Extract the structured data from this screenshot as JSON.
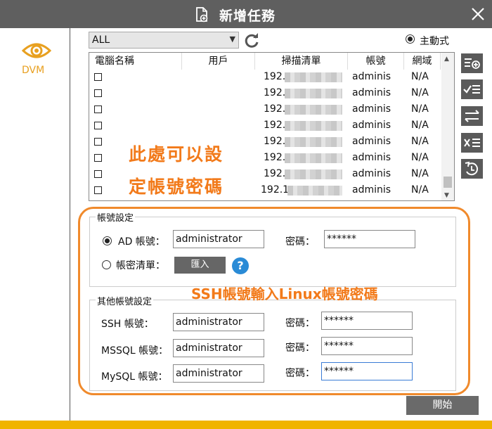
{
  "window": {
    "title": "新增任務",
    "close_icon": "close-icon"
  },
  "sidebar": {
    "label": "DVM",
    "icon": "eye-icon"
  },
  "toolbar": {
    "filter_value": "ALL",
    "active_mode_label": "主動式"
  },
  "table": {
    "headers": [
      "電腦名稱",
      "用戶",
      "掃描清單",
      "帳號",
      "網域"
    ],
    "rows": [
      {
        "ip": "192.",
        "account": "adminis",
        "domain": "N/A"
      },
      {
        "ip": "192.",
        "account": "adminis",
        "domain": "N/A"
      },
      {
        "ip": "192.",
        "account": "adminis",
        "domain": "N/A"
      },
      {
        "ip": "192.",
        "account": "adminis",
        "domain": "N/A"
      },
      {
        "ip": "192.",
        "account": "adminis",
        "domain": "N/A"
      },
      {
        "ip": "192.",
        "account": "adminis",
        "domain": "N/A"
      },
      {
        "ip": "192.",
        "account": "adminis",
        "domain": "N/A"
      },
      {
        "ip": "192.1",
        "account": "adminis",
        "domain": "N/A"
      }
    ]
  },
  "side_tools": [
    "add-list-icon",
    "check-list-icon",
    "swap-icon",
    "delete-list-icon",
    "reset-icon"
  ],
  "annotations": {
    "top_line1": "此處可以設",
    "top_line2": "定帳號密碼",
    "ssh_note": "SSH帳號輸入Linux帳號密碼"
  },
  "account_settings": {
    "title": "帳號設定",
    "ad_label": "AD 帳號：",
    "ad_value": "administrator",
    "password_label": "密碼：",
    "ad_password": "******",
    "list_label": "帳密清單：",
    "import_label": "匯入",
    "help": "?"
  },
  "other_settings": {
    "title": "其他帳號設定",
    "ssh_label": "SSH 帳號：",
    "ssh_value": "administrator",
    "ssh_password": "******",
    "mssql_label": "MSSQL 帳號：",
    "mssql_value": "administrator",
    "mssql_password": "******",
    "mysql_label": "MySQL 帳號：",
    "mysql_value": "administrator",
    "mysql_password": "******",
    "password_label": "密碼："
  },
  "footer": {
    "start_label": "開始"
  },
  "colors": {
    "accent": "#f08a2c",
    "titlebar": "#5f5f5f",
    "brand": "#f0b400",
    "link": "#2a8bd6"
  }
}
